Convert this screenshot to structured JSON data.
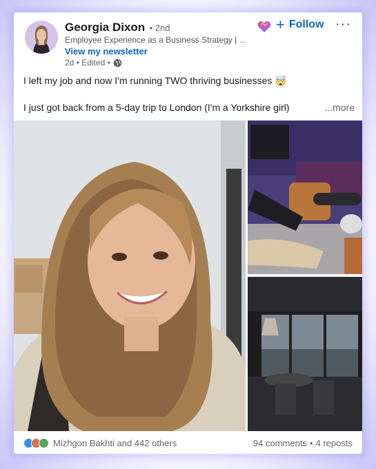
{
  "post": {
    "author": {
      "name": "Georgia Dixon",
      "degree": "• 2nd",
      "headline": "Employee Experience as a Business Strategy | ...",
      "newsletter_link": "View my newsletter",
      "meta": "2d • Edited •"
    },
    "actions": {
      "follow_label": "Follow",
      "more_label": "···"
    },
    "text": {
      "line1": "I left my job and now I'm running TWO thriving businesses",
      "line1_emoji": "🤯",
      "line2": "I just got back from a 5-day trip to London (I'm a Yorkshire girl)",
      "see_more": "...more"
    },
    "social": {
      "reactions_label": "Mizhgon Bakhti and 442 others",
      "comments": "94 comments",
      "separator": "•",
      "reposts": "4 reposts"
    }
  },
  "icons": {
    "globe": "globe-icon",
    "heart": "heart-badge-icon",
    "plus": "plus-icon",
    "reactions": [
      "like-reaction-icon",
      "love-reaction-icon",
      "insightful-reaction-icon"
    ]
  },
  "colors": {
    "accent": "#0a66c2",
    "text": "#191919",
    "muted": "#666666",
    "glow": "#c9c6f7"
  }
}
